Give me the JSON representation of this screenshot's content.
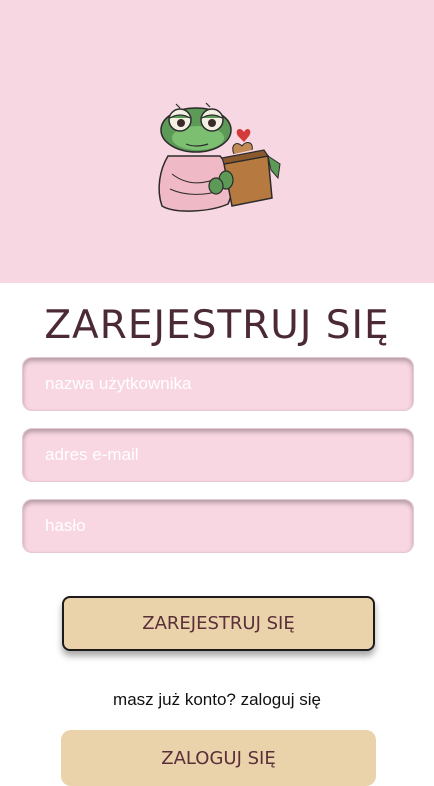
{
  "hero": {
    "background": "#f7d7e2",
    "image_name": "frog-mascot-with-plant"
  },
  "form": {
    "title": "ZAREJESTRUJ SIĘ",
    "username_placeholder": "nazwa użytkownika",
    "email_placeholder": "adres e-mail",
    "password_placeholder": "hasło",
    "register_label": "ZAREJESTRUJ SIĘ"
  },
  "login": {
    "hint": "masz już konto? zaloguj się",
    "button_label": "ZALOGUJ SIĘ"
  },
  "colors": {
    "pink": "#f8d6e2",
    "beige_button": "#ead2ab",
    "title_text": "#4b2a35"
  }
}
